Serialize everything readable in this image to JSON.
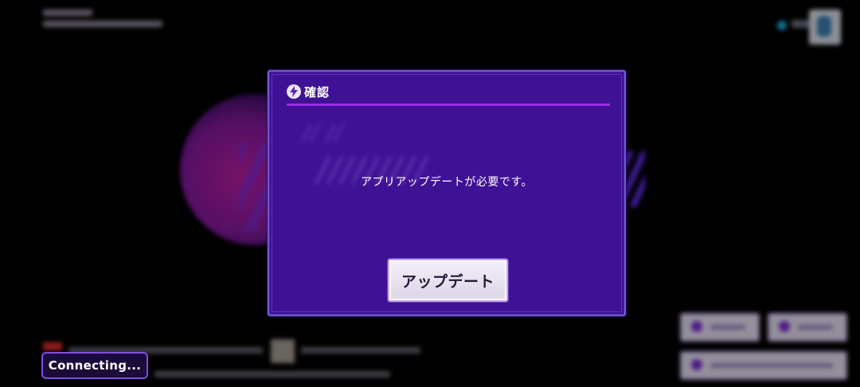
{
  "dialog": {
    "title": "確認",
    "icon": "lightning-bolt-icon",
    "message": "アプリアップデートが必要です。",
    "button_label": "アップデート"
  },
  "status": {
    "connecting_text": "Connecting..."
  },
  "colors": {
    "dialog_background": "#3f1195",
    "dialog_border": "#6f5ad2",
    "title_rule": "#9a2be6",
    "button_background": "#e8e2f2",
    "badge_border": "#7c4fe0"
  }
}
